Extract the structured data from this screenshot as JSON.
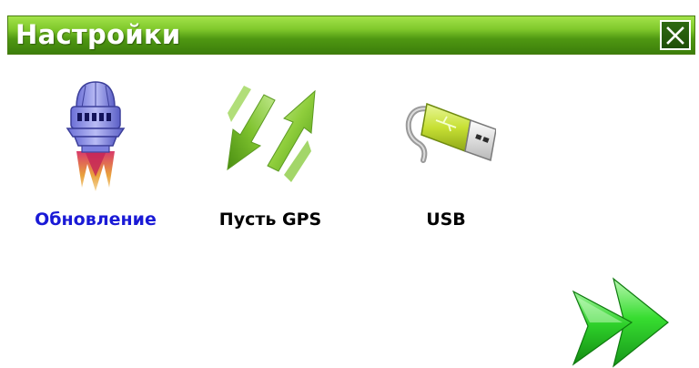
{
  "window": {
    "title": "Настройки",
    "close_icon": "close-icon"
  },
  "tiles": [
    {
      "label": "Обновление",
      "icon": "update-rocket-icon",
      "selected": true,
      "label_color": "#1a1ad6"
    },
    {
      "label": "Пусть GPS",
      "icon": "gps-path-arrows-icon",
      "selected": false,
      "label_color": "#000000"
    },
    {
      "label": "USB",
      "icon": "usb-drive-icon",
      "selected": false,
      "label_color": "#000000"
    }
  ],
  "navigation": {
    "next_icon": "double-arrow-right-icon"
  },
  "colors": {
    "titlebar_green": "#5aa61a",
    "selected_label": "#1a1ad6",
    "accent_green": "#2bbf2b"
  }
}
